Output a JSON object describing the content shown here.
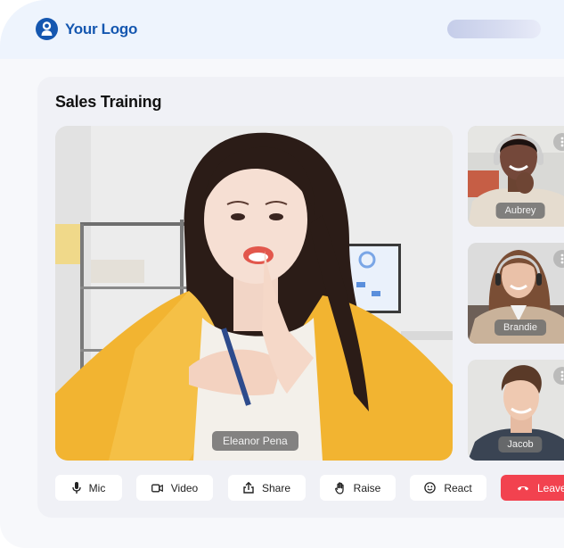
{
  "header": {
    "logo_icon": "user-circle-icon",
    "logo_text": "Your Logo",
    "brand_color": "#1557b0"
  },
  "meeting": {
    "title": "Sales Training",
    "main_speaker": {
      "name": "Eleanor Pena"
    },
    "participants": [
      {
        "name": "Aubrey",
        "menu_icon": "more-vertical-icon"
      },
      {
        "name": "Brandie",
        "menu_icon": "more-vertical-icon"
      },
      {
        "name": "Jacob",
        "menu_icon": "more-vertical-icon"
      }
    ]
  },
  "controls": {
    "buttons": [
      {
        "label": "Mic",
        "icon": "microphone-icon"
      },
      {
        "label": "Video",
        "icon": "video-camera-icon"
      },
      {
        "label": "Share",
        "icon": "share-upload-icon"
      },
      {
        "label": "Raise",
        "icon": "raise-hand-icon"
      },
      {
        "label": "React",
        "icon": "smiley-icon"
      },
      {
        "label": "Leave",
        "icon": "hang-up-phone-icon"
      }
    ],
    "leave_color": "#f2424f"
  }
}
